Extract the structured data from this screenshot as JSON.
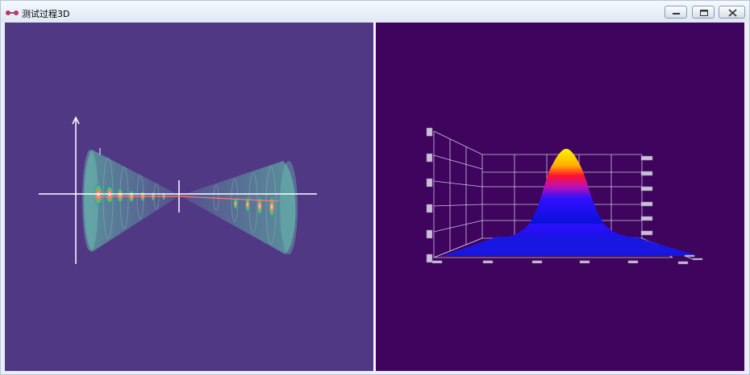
{
  "window": {
    "title": "测试过程3D",
    "app_icon": "connector-icon",
    "controls": [
      "minimize-icon",
      "restore-icon",
      "close-icon"
    ]
  },
  "views": {
    "left": {
      "name": "beam-propagation-3d-view",
      "background": "#513885"
    },
    "right": {
      "name": "gaussian-surface-3d-view",
      "background": "#3e045e"
    }
  },
  "colors": {
    "peak": "#ffe600",
    "mid": "#ff1030",
    "base": "#0a10ff",
    "grid": "#d8cfe6"
  }
}
